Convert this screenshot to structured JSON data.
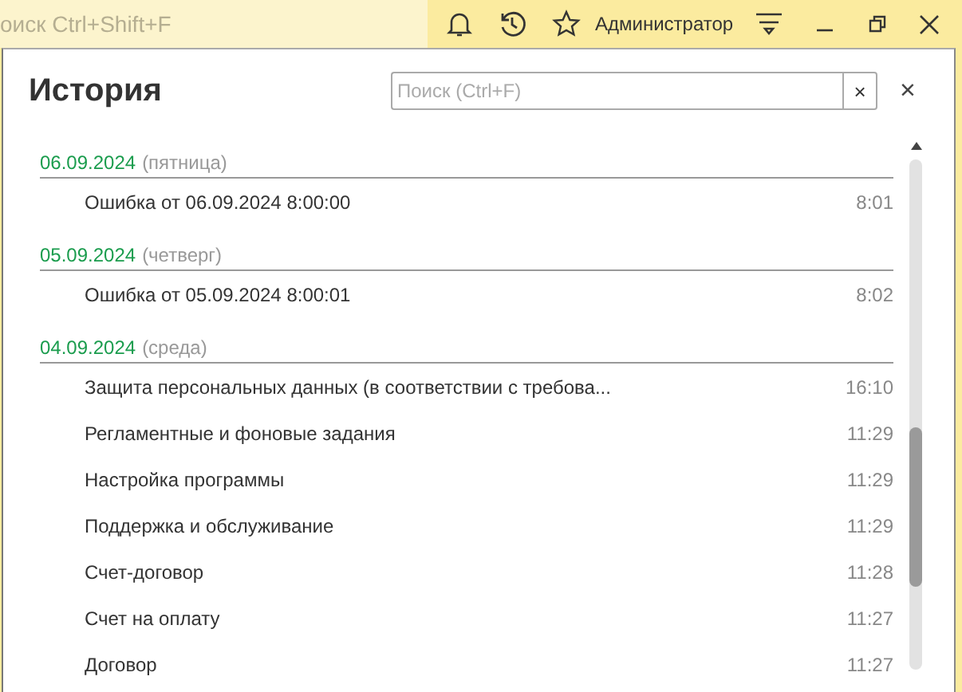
{
  "top_bar": {
    "search": {
      "placeholder": "оиск Ctrl+Shift+F"
    },
    "user": "Администратор"
  },
  "window": {
    "title": "История",
    "search": {
      "placeholder": "Поиск (Ctrl+F)"
    },
    "clear_button": "×",
    "close_button": "×"
  },
  "groups": [
    {
      "date": "06.09.2024",
      "weekday": "(пятница)",
      "items": [
        {
          "label": "Ошибка от 06.09.2024 8:00:00",
          "time": "8:01"
        }
      ]
    },
    {
      "date": "05.09.2024",
      "weekday": "(четверг)",
      "items": [
        {
          "label": "Ошибка от 05.09.2024 8:00:01",
          "time": "8:02"
        }
      ]
    },
    {
      "date": "04.09.2024",
      "weekday": "(среда)",
      "items": [
        {
          "label": "Защита персональных данных (в соответствии с требова...",
          "time": "16:10"
        },
        {
          "label": "Регламентные и фоновые задания",
          "time": "11:29"
        },
        {
          "label": "Настройка программы",
          "time": "11:29"
        },
        {
          "label": "Поддержка и обслуживание",
          "time": "11:29"
        },
        {
          "label": "Счет-договор",
          "time": "11:28"
        },
        {
          "label": "Счет на оплату",
          "time": "11:27"
        },
        {
          "label": "Договор",
          "time": "11:27"
        }
      ]
    }
  ]
}
